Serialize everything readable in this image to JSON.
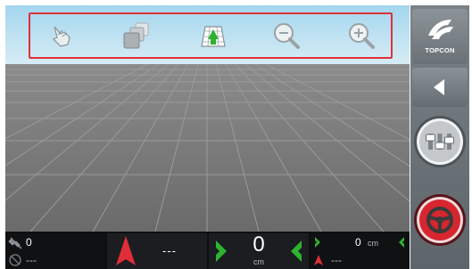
{
  "toolbar": {
    "tools": [
      {
        "name": "hand-pan-icon"
      },
      {
        "name": "view-layers-icon"
      },
      {
        "name": "field-grid-icon"
      },
      {
        "name": "zoom-out-icon"
      },
      {
        "name": "zoom-in-icon"
      }
    ]
  },
  "sidebar": {
    "logo_text": "TOPCON",
    "collapse_icon": "left-arrow-icon",
    "settings_icon": "sliders-icon",
    "steering_icon": "steering-wheel-icon"
  },
  "status": {
    "satellite_count": "0",
    "satellite_quality": "---",
    "heading_value": "---",
    "offset_value": "0",
    "offset_unit": "cm",
    "secondary_value": "0",
    "secondary_unit": "cm",
    "secondary_sub": "---"
  },
  "colors": {
    "sky_top": "#9ccfe6",
    "ground": "#6f6f6f",
    "accent_red": "#e0303a",
    "guidance_green": "#2fb22f"
  }
}
